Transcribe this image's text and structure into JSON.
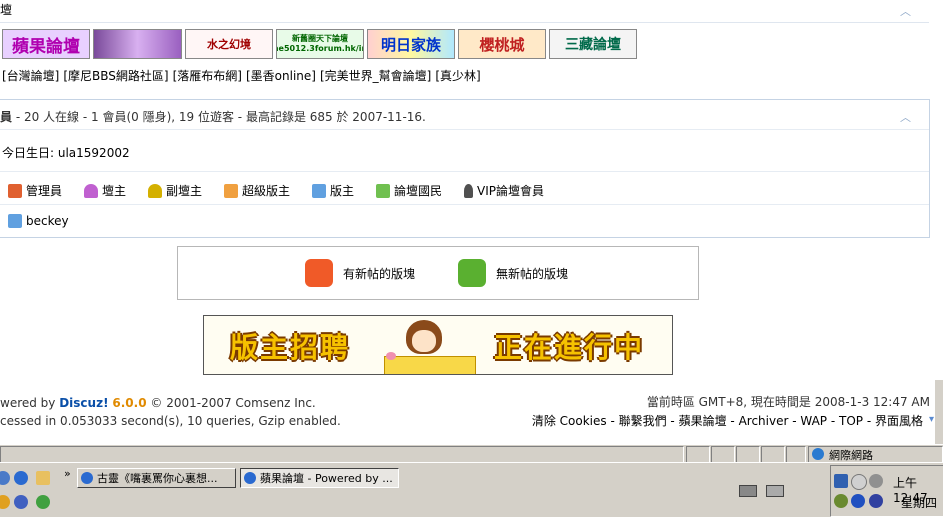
{
  "friend_links": {
    "partial_title": "壇",
    "logos": [
      {
        "label": "蘋果論壇",
        "bg": "#e8d0ff",
        "fg": "#b000b0"
      },
      {
        "label": "",
        "bg": "#caa0e8",
        "fg": "#5a1a7a"
      },
      {
        "label": "水之幻境",
        "bg": "#fff6f6",
        "fg": "#a00000"
      },
      {
        "label": "新舊圈天下論壇 he5012.3forum.hk/in",
        "bg": "#e8fbe8",
        "fg": "#006600"
      },
      {
        "label": "明日家族",
        "bg": "#cfe6ff",
        "fg": "#0033cc"
      },
      {
        "label": "櫻桃城",
        "bg": "#ffe9c8",
        "fg": "#c02020"
      },
      {
        "label": "三藏論壇",
        "bg": "#f4f4f4",
        "fg": "#006a4a"
      }
    ],
    "text_links": [
      "[台灣論壇]",
      "[摩尼BBS網路社區]",
      "[落雁布布網]",
      "[墨香online]",
      "[完美世界_幫會論壇]",
      "[真少林]"
    ]
  },
  "online": {
    "summary_prefix": "員",
    "summary": " - 20 人在線 - 1 會員(0 隱身), 19 位遊客 - 最高記錄是 685 於 2007-11-16.",
    "birthday": "今日生日: ula1592002",
    "legend": [
      {
        "label": "管理員",
        "color": "#e06030"
      },
      {
        "label": "壇主",
        "color": "#c060d0"
      },
      {
        "label": "副壇主",
        "color": "#d4b000"
      },
      {
        "label": "超級版主",
        "color": "#f0a040"
      },
      {
        "label": "版主",
        "color": "#60a0e0"
      },
      {
        "label": "論壇國民",
        "color": "#70c050"
      },
      {
        "label": "VIP論壇會員",
        "color": "#505050"
      }
    ],
    "users": [
      "beckey"
    ]
  },
  "forum_legend": {
    "new_label": "有新帖的版塊",
    "nonew_label": "無新帖的版塊"
  },
  "banner": {
    "left": "版主招聘",
    "right": "正在進行中"
  },
  "footer": {
    "powered_prefix": "wered by ",
    "brand": "Discuz!",
    "version": "6.0.0",
    "copyright": "© 2001-2007 Comsenz Inc.",
    "processed": "cessed in 0.053033 second(s), 10 queries, Gzip enabled.",
    "time": "當前時區 GMT+8, 現在時間是 2008-1-3 12:47 AM",
    "links": [
      "清除 Cookies",
      "聯繫我們",
      "蘋果論壇",
      "Archiver",
      "WAP",
      "TOP",
      "界面風格"
    ]
  },
  "statusbar": {
    "zone": "網際網路"
  },
  "taskbar": {
    "buttons": [
      {
        "label": "古靈《嘴裏罵你心裏想...",
        "pressed": false
      },
      {
        "label": "蘋果論壇 - Powered by ...",
        "pressed": true
      }
    ],
    "clock": "上午 12:47",
    "day": "星期四"
  }
}
